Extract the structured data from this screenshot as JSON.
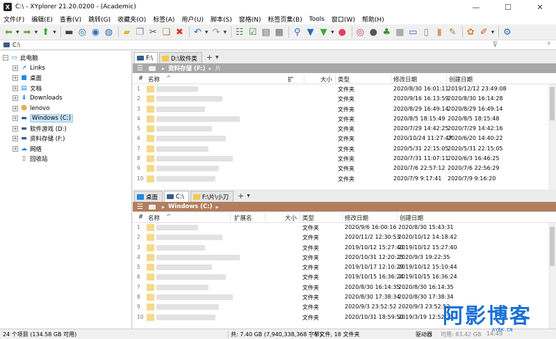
{
  "window": {
    "title": "C:\\ - XYplorer 21.20.0200 - (Academic)",
    "logo_text": "X"
  },
  "menu": [
    "文件(F)",
    "编辑(E)",
    "查看(V)",
    "跳转(G)",
    "收藏夹(O)",
    "标签(A)",
    "用户(U)",
    "脚本(S)",
    "窗格(N)",
    "标签页集(B)",
    "Tools",
    "窗口(W)",
    "帮助(H)"
  ],
  "address": {
    "path": "C:\\"
  },
  "tree": [
    {
      "label": "此电脑",
      "icon": "computer-icon",
      "level": 0,
      "expander": "−"
    },
    {
      "label": "Links",
      "icon": "links-icon",
      "level": 1,
      "expander": "+"
    },
    {
      "label": "桌面",
      "icon": "desktop-icon",
      "level": 1,
      "expander": "+"
    },
    {
      "label": "文档",
      "icon": "documents-icon",
      "level": 1,
      "expander": "+"
    },
    {
      "label": "Downloads",
      "icon": "downloads-icon",
      "level": 1,
      "expander": "+"
    },
    {
      "label": "lenovo",
      "icon": "user-icon",
      "level": 1,
      "expander": "+"
    },
    {
      "label": "Windows (C:)",
      "icon": "drive-icon",
      "level": 1,
      "expander": "+",
      "selected": true
    },
    {
      "label": "软件游戏 (D:)",
      "icon": "drive-icon",
      "level": 1,
      "expander": "+"
    },
    {
      "label": "资料存储 (F:)",
      "icon": "drive-icon",
      "level": 1,
      "expander": "+"
    },
    {
      "label": "网络",
      "icon": "network-icon",
      "level": 1,
      "expander": "+"
    },
    {
      "label": "回收站",
      "icon": "recycle-bin-icon",
      "level": 1,
      "expander": ""
    }
  ],
  "top_pane": {
    "tabs": [
      {
        "label": "F:\\",
        "icon": "drive",
        "active": true
      },
      {
        "label": "D:\\软件类",
        "icon": "folder",
        "active": false
      }
    ],
    "crumbs": [
      "资料存储 (F:)",
      "片"
    ],
    "columns": {
      "num": "#",
      "name": "名称",
      "ext": "扩",
      "size": "大小",
      "type": "类型",
      "modified": "修改日期",
      "created": "创建日期"
    },
    "rows": [
      {
        "idx": "1",
        "type": "文件夹",
        "modified": "2020/8/30 16:01:11",
        "created": "2019/12/12 23:49:08"
      },
      {
        "idx": "2",
        "type": "文件夹",
        "modified": "2020/9/16 16:13:59",
        "created": "2020/8/30 16:14:28"
      },
      {
        "idx": "3",
        "type": "文件夹",
        "modified": "2020/8/29 16:49:14",
        "created": "2020/8/29 16:49:14"
      },
      {
        "idx": "4",
        "type": "文件夹",
        "modified": "2020/8/5 18:15:49",
        "created": "2020/8/5 18:15:48"
      },
      {
        "idx": "5",
        "type": "文件夹",
        "modified": "2020/7/29 14:42:25",
        "created": "2020/7/29 14:42:16"
      },
      {
        "idx": "6",
        "type": "文件夹",
        "modified": "2020/10/24 11:27:47",
        "created": "2020/6/20 14:40:22"
      },
      {
        "idx": "7",
        "type": "文件夹",
        "modified": "2020/5/31 22:15:05",
        "created": "2020/5/31 22:15:05"
      },
      {
        "idx": "8",
        "type": "文件夹",
        "modified": "2020/7/31 11:07:11",
        "created": "2020/6/3 16:46:25"
      },
      {
        "idx": "9",
        "type": "文件夹",
        "modified": "2020/7/6 22:57:12",
        "created": "2020/7/6 22:56:29"
      },
      {
        "idx": "10",
        "type": "文件夹",
        "modified": "2020/7/9 9:17:41",
        "created": "2020/7/9 9:16:20"
      }
    ]
  },
  "bottom_pane": {
    "tabs": [
      {
        "label": "桌面",
        "icon": "desktop",
        "active": false
      },
      {
        "label": "C:\\",
        "icon": "drive",
        "active": true
      },
      {
        "label": "F:\\片\\小刀",
        "icon": "folder",
        "active": false
      }
    ],
    "crumbs": [
      "Windows (C:)"
    ],
    "columns": {
      "num": "#",
      "name": "名称",
      "ext": "扩展名",
      "size": "大小",
      "type": "类型",
      "modified": "修改日期",
      "created": "创建日期"
    },
    "rows": [
      {
        "idx": "1",
        "type": "文件夹",
        "modified": "2020/9/6 16:00:16",
        "created": "2020/8/30 15:43:31"
      },
      {
        "idx": "2",
        "type": "文件夹",
        "modified": "2020/11/2 12:30:53",
        "created": "2020/10/12 14:18:42"
      },
      {
        "idx": "3",
        "type": "文件夹",
        "modified": "2019/10/12 15:27:40",
        "created": "2019/10/12 15:27:40"
      },
      {
        "idx": "4",
        "type": "文件夹",
        "modified": "2020/10/31 12:20:25",
        "created": "2020/9/3 19:22:35"
      },
      {
        "idx": "5",
        "type": "文件夹",
        "modified": "2019/10/17 12:10:29",
        "created": "2019/10/12 15:10:44"
      },
      {
        "idx": "6",
        "type": "文件夹",
        "modified": "2019/10/15 16:36:24",
        "created": "2019/10/15 16:36:24"
      },
      {
        "idx": "7",
        "type": "文件夹",
        "modified": "2020/8/30 16:14:35",
        "created": "2020/8/30 16:14:35"
      },
      {
        "idx": "8",
        "type": "文件夹",
        "modified": "2020/8/30 17:38:34",
        "created": "2020/8/30 17:38:34"
      },
      {
        "idx": "9",
        "type": "文件夹",
        "modified": "2020/9/3 23:52:52",
        "created": "2020/9/3 23:52:52"
      },
      {
        "idx": "10",
        "type": "文件夹",
        "modified": "2020/10/31 18:59:50",
        "created": "2019/3/19 12:52:23"
      }
    ]
  },
  "status": {
    "items": "24 个项目 (134.58 GB 可用)",
    "total": "共: 7.40 GB (7,940,338,368 字节)",
    "counts": "6 文件, 18 文件夹",
    "drive": "驱动器",
    "free": "可用: 83.42 GB",
    "time": "14:49"
  },
  "watermark": {
    "text": "阿影博客",
    "sub": "AYBK.CN"
  }
}
